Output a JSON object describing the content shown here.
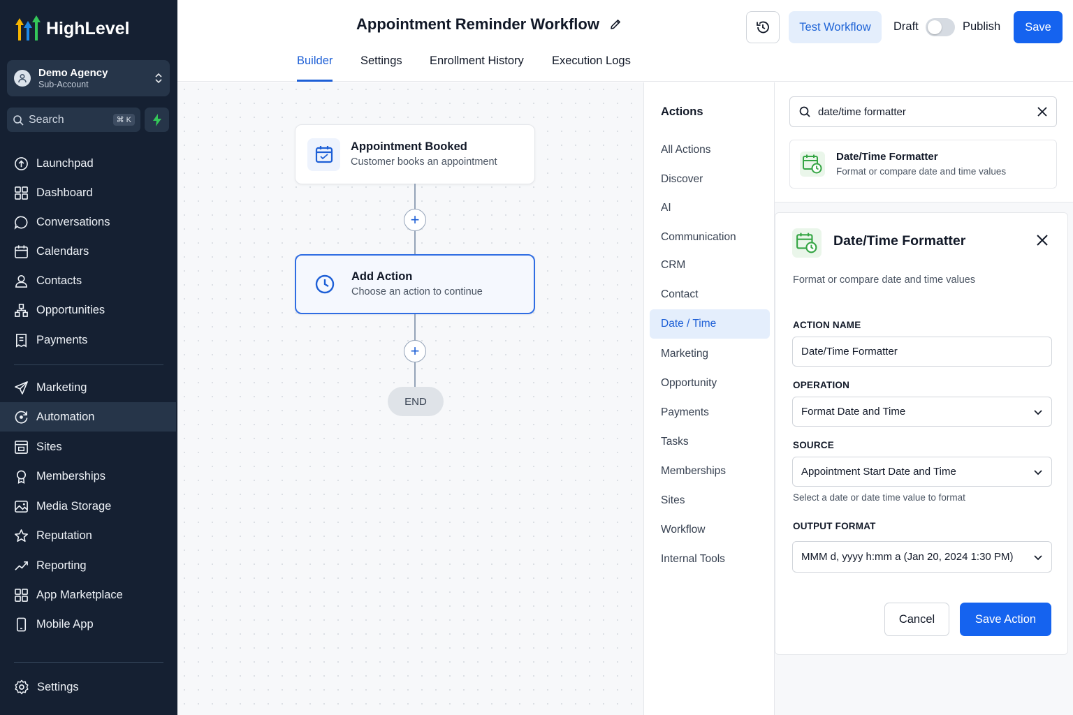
{
  "brand": {
    "name": "HighLevel",
    "accent": "#1563ef"
  },
  "account": {
    "name": "Demo Agency",
    "type": "Sub-Account"
  },
  "search": {
    "label": "Search",
    "shortcut": "⌘ K"
  },
  "nav": {
    "main": [
      "Launchpad",
      "Dashboard",
      "Conversations",
      "Calendars",
      "Contacts",
      "Opportunities",
      "Payments"
    ],
    "secondary": [
      "Marketing",
      "Automation",
      "Sites",
      "Memberships",
      "Media Storage",
      "Reputation",
      "Reporting",
      "App Marketplace",
      "Mobile App"
    ],
    "active": "Automation",
    "settings": "Settings"
  },
  "header": {
    "title": "Appointment Reminder Workflow",
    "test_label": "Test Workflow",
    "draft_label": "Draft",
    "publish_label": "Publish",
    "save_label": "Save",
    "tabs": [
      "Builder",
      "Settings",
      "Enrollment History",
      "Execution Logs"
    ],
    "active_tab": "Builder"
  },
  "canvas": {
    "trigger": {
      "title": "Appointment Booked",
      "subtitle": "Customer books an appointment"
    },
    "action": {
      "title": "Add Action",
      "subtitle": "Choose an action to continue"
    },
    "end_label": "END"
  },
  "actions_panel": {
    "heading": "Actions",
    "categories": [
      "All Actions",
      "Discover",
      "AI",
      "Communication",
      "CRM",
      "Contact",
      "Date / Time",
      "Marketing",
      "Opportunity",
      "Payments",
      "Tasks",
      "Memberships",
      "Sites",
      "Workflow",
      "Internal Tools"
    ],
    "active": "Date / Time"
  },
  "action_search": {
    "value": "date/time formatter",
    "result": {
      "title": "Date/Time Formatter",
      "subtitle": "Format or compare date and time values"
    }
  },
  "config": {
    "title": "Date/Time Formatter",
    "description": "Format or compare date and time values",
    "action_name_label": "ACTION NAME",
    "action_name_value": "Date/Time Formatter",
    "operation_label": "OPERATION",
    "operation_value": "Format Date and Time",
    "source_label": "SOURCE",
    "source_value": "Appointment Start Date and Time",
    "source_hint": "Select a date or date time value to format",
    "output_format_label": "OUTPUT FORMAT",
    "output_format_value": "MMM d, yyyy h:mm a (Jan 20, 2024 1:30 PM)",
    "cancel_label": "Cancel",
    "save_label": "Save Action"
  }
}
